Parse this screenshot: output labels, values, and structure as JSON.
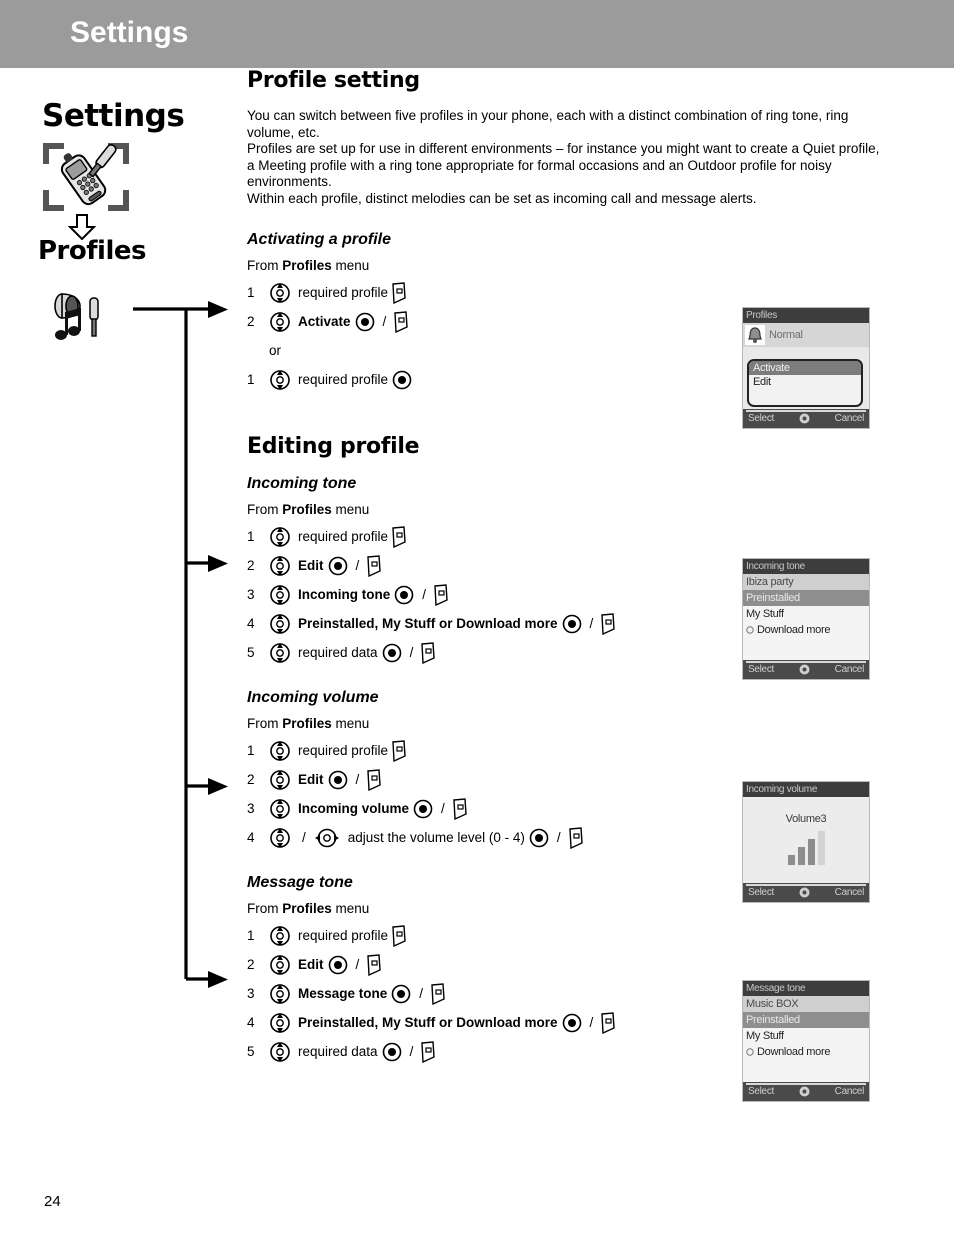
{
  "header": {
    "title": "Settings"
  },
  "sidebar": {
    "title": "Settings",
    "subtitle": "Profiles",
    "phone_icon": "phone-screwdriver-icon",
    "down_arrow_icon": "arrow-down-icon",
    "profile_icon": "speaker-music-screwdriver-icon"
  },
  "content": {
    "section_title": "Profile setting",
    "intro": "You can switch between five profiles in your phone, each with a distinct combination of ring tone, ring volume, etc.\nProfiles are set up for use in different environments – for instance you might want to create a Quiet profile, a Meeting profile with a ring tone appropriate for formal occasions and an Outdoor profile for noisy environments.\nWithin each profile, distinct melodies can be set as incoming call and message alerts.",
    "activating": {
      "heading": "Activating a profile",
      "from_prefix": "From ",
      "from_bold": "Profiles",
      "from_suffix": " menu",
      "or_label": "or",
      "steps": [
        {
          "num": "1",
          "text": "required profile",
          "bold": false
        },
        {
          "num": "2",
          "text": "Activate",
          "bold": true
        }
      ],
      "alt_steps": [
        {
          "num": "1",
          "text": "required profile",
          "bold": false
        }
      ]
    },
    "editing_title": "Editing profile",
    "incoming_tone": {
      "heading": "Incoming tone",
      "from_prefix": "From ",
      "from_bold": "Profiles",
      "from_suffix": " menu",
      "steps": [
        {
          "num": "1",
          "text": "required profile"
        },
        {
          "num": "2",
          "text": "Edit"
        },
        {
          "num": "3",
          "text": "Incoming tone"
        },
        {
          "num": "4",
          "text": "Preinstalled, My Stuff or Download more"
        },
        {
          "num": "5",
          "text": "required data"
        }
      ]
    },
    "incoming_volume": {
      "heading": "Incoming volume",
      "from_prefix": "From ",
      "from_bold": "Profiles",
      "from_suffix": " menu",
      "steps": [
        {
          "num": "1",
          "text": "required profile"
        },
        {
          "num": "2",
          "text": "Edit"
        },
        {
          "num": "3",
          "text": "Incoming volume"
        },
        {
          "num": "4",
          "text": "adjust the volume level (0 - 4)"
        }
      ]
    },
    "message_tone": {
      "heading": "Message tone",
      "from_prefix": "From ",
      "from_bold": "Profiles",
      "from_suffix": " menu",
      "steps": [
        {
          "num": "1",
          "text": "required profile"
        },
        {
          "num": "2",
          "text": "Edit"
        },
        {
          "num": "3",
          "text": "Message tone"
        },
        {
          "num": "4",
          "text": "Preinstalled, My Stuff or Download more"
        },
        {
          "num": "5",
          "text": "required data"
        }
      ]
    }
  },
  "screens": {
    "profiles": {
      "title": "Profiles",
      "item": "Normal",
      "popup": [
        "Activate",
        "Edit"
      ],
      "softkey_left": "Select",
      "softkey_right": "Cancel"
    },
    "incoming_tone": {
      "title": "Incoming tone",
      "current": "Ibiza party",
      "options": [
        "Preinstalled",
        "My Stuff",
        "Download more"
      ],
      "softkey_left": "Select",
      "softkey_right": "Cancel"
    },
    "incoming_volume": {
      "title": "Incoming volume",
      "value_label": "Volume3",
      "bars_total": 4,
      "bars_filled": 3,
      "softkey_left": "Select",
      "softkey_right": "Cancel"
    },
    "message_tone": {
      "title": "Message tone",
      "current": "Music BOX",
      "options": [
        "Preinstalled",
        "My Stuff",
        "Download more"
      ],
      "softkey_left": "Select",
      "softkey_right": "Cancel"
    }
  },
  "footer": {
    "page_number": "24"
  },
  "colors": {
    "header_bg": "#9b9b9b",
    "header_text": "#ffffff",
    "screen_title_bg": "#3d3d3d"
  }
}
